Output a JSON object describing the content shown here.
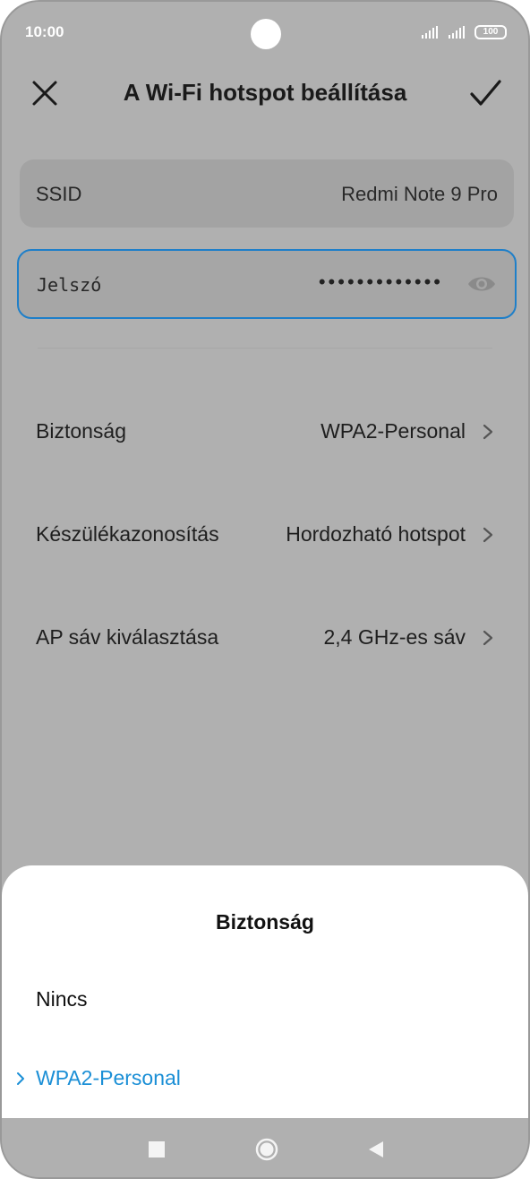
{
  "status_bar": {
    "time": "10:00",
    "battery": "100",
    "icons": [
      "signal-icon",
      "signal-icon",
      "battery-icon"
    ]
  },
  "header": {
    "title": "A Wi-Fi hotspot beállítása",
    "close_icon": "close-icon",
    "confirm_icon": "check-icon"
  },
  "ssid": {
    "label": "SSID",
    "value": "Redmi Note 9 Pro"
  },
  "password": {
    "label": "Jelszó",
    "masked_value": "•••••••••••••",
    "icon": "eye-icon"
  },
  "settings": [
    {
      "label": "Biztonság",
      "value": "WPA2-Personal"
    },
    {
      "label": "Készülékazonosítás",
      "value": "Hordozható hotspot"
    },
    {
      "label": "AP sáv kiválasztása",
      "value": "2,4 GHz-es sáv"
    }
  ],
  "sheet": {
    "title": "Biztonság",
    "options": [
      {
        "label": "Nincs",
        "selected": false
      },
      {
        "label": "WPA2-Personal",
        "selected": true
      }
    ]
  },
  "colors": {
    "accent": "#1b8fd6",
    "focus_border": "#1e7fc9",
    "dim_background": "#b0b0b0"
  },
  "nav_bar": {
    "icons": [
      "recents-icon",
      "home-icon",
      "back-icon"
    ]
  }
}
